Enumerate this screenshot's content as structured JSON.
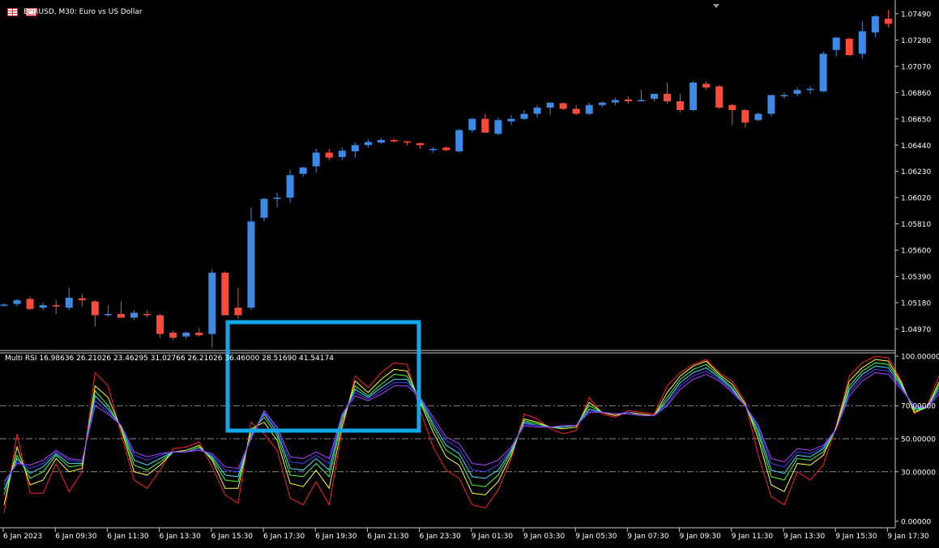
{
  "window": {
    "title": "EURUSD, M30:  Euro vs US Dollar"
  },
  "icons": [
    "chart-window-icon",
    "restore-icon"
  ],
  "colors": {
    "background": "#000000",
    "bull": "#3d8ae6",
    "bear": "#ff4a3a",
    "axis": "#c8c8c8",
    "level_line": "#8a8a8a",
    "highlight_box": "#11a7e8"
  },
  "price_axis": {
    "labels": [
      "1.07490",
      "1.07280",
      "1.07070",
      "1.06860",
      "1.06650",
      "1.06440",
      "1.06230",
      "1.06020",
      "1.05810",
      "1.05600",
      "1.05390",
      "1.05180",
      "1.04970"
    ]
  },
  "rsi_axis": {
    "labels": [
      "100.00000",
      "70.00000",
      "50.00000",
      "30.00000",
      "0.00000"
    ],
    "levels": [
      70,
      50,
      30
    ]
  },
  "time_axis": {
    "labels": [
      "6 Jan 2023",
      "6 Jan 09:30",
      "6 Jan 11:30",
      "6 Jan 13:30",
      "6 Jan 15:30",
      "6 Jan 17:30",
      "6 Jan 19:30",
      "6 Jan 21:30",
      "6 Jan 23:30",
      "9 Jan 01:30",
      "9 Jan 03:30",
      "9 Jan 05:30",
      "9 Jan 07:30",
      "9 Jan 09:30",
      "9 Jan 11:30",
      "9 Jan 13:30",
      "9 Jan 15:30",
      "9 Jan 17:30"
    ]
  },
  "indicator": {
    "title": "Multi RSI 16.98636 26.21026 23.46295 31.02766 26.21026 36.46000 28.51690 41.54174",
    "values": [
      16.98636,
      26.21026,
      23.46295,
      31.02766,
      26.21026,
      36.46,
      28.5169,
      41.54174
    ]
  },
  "chart_data": {
    "type": "candlestick",
    "symbol": "EURUSD",
    "timeframe": "M30",
    "candles": [
      {
        "o": 1.05165,
        "h": 1.05175,
        "l": 1.0515,
        "c": 1.05165
      },
      {
        "o": 1.0517,
        "h": 1.0521,
        "l": 1.0515,
        "c": 1.052
      },
      {
        "o": 1.0521,
        "h": 1.0523,
        "l": 1.0512,
        "c": 1.0513
      },
      {
        "o": 1.0514,
        "h": 1.0518,
        "l": 1.0512,
        "c": 1.0516
      },
      {
        "o": 1.0516,
        "h": 1.052,
        "l": 1.0509,
        "c": 1.0515
      },
      {
        "o": 1.0514,
        "h": 1.053,
        "l": 1.0512,
        "c": 1.0522
      },
      {
        "o": 1.05215,
        "h": 1.0525,
        "l": 1.0515,
        "c": 1.052
      },
      {
        "o": 1.0519,
        "h": 1.052,
        "l": 1.0499,
        "c": 1.0508
      },
      {
        "o": 1.0508,
        "h": 1.0516,
        "l": 1.0507,
        "c": 1.0509
      },
      {
        "o": 1.0509,
        "h": 1.0519,
        "l": 1.0506,
        "c": 1.0506
      },
      {
        "o": 1.0506,
        "h": 1.0512,
        "l": 1.0504,
        "c": 1.051
      },
      {
        "o": 1.0509,
        "h": 1.0512,
        "l": 1.0506,
        "c": 1.0508
      },
      {
        "o": 1.0508,
        "h": 1.0509,
        "l": 1.049,
        "c": 1.0493
      },
      {
        "o": 1.0494,
        "h": 1.0496,
        "l": 1.0488,
        "c": 1.049
      },
      {
        "o": 1.0491,
        "h": 1.0495,
        "l": 1.0489,
        "c": 1.0494
      },
      {
        "o": 1.0494,
        "h": 1.0498,
        "l": 1.0491,
        "c": 1.0492
      },
      {
        "o": 1.0493,
        "h": 1.0545,
        "l": 1.0482,
        "c": 1.0542
      },
      {
        "o": 1.0542,
        "h": 1.0543,
        "l": 1.0508,
        "c": 1.0508
      },
      {
        "o": 1.0514,
        "h": 1.053,
        "l": 1.0505,
        "c": 1.0508
      },
      {
        "o": 1.0514,
        "h": 1.0594,
        "l": 1.0512,
        "c": 1.0583
      },
      {
        "o": 1.0586,
        "h": 1.0602,
        "l": 1.0583,
        "c": 1.0601
      },
      {
        "o": 1.0601,
        "h": 1.0606,
        "l": 1.0594,
        "c": 1.0602
      },
      {
        "o": 1.0602,
        "h": 1.0624,
        "l": 1.0598,
        "c": 1.062
      },
      {
        "o": 1.0621,
        "h": 1.0627,
        "l": 1.0619,
        "c": 1.0626
      },
      {
        "o": 1.0627,
        "h": 1.0641,
        "l": 1.0622,
        "c": 1.0638
      },
      {
        "o": 1.0638,
        "h": 1.0641,
        "l": 1.0632,
        "c": 1.0634
      },
      {
        "o": 1.06345,
        "h": 1.0642,
        "l": 1.0632,
        "c": 1.06395
      },
      {
        "o": 1.0639,
        "h": 1.0646,
        "l": 1.0634,
        "c": 1.0644
      },
      {
        "o": 1.0644,
        "h": 1.0649,
        "l": 1.0642,
        "c": 1.06465
      },
      {
        "o": 1.0646,
        "h": 1.06495,
        "l": 1.0645,
        "c": 1.0648
      },
      {
        "o": 1.0648,
        "h": 1.0649,
        "l": 1.0646,
        "c": 1.0647
      },
      {
        "o": 1.0647,
        "h": 1.06475,
        "l": 1.0644,
        "c": 1.0646
      },
      {
        "o": 1.06455,
        "h": 1.0646,
        "l": 1.0641,
        "c": 1.0644
      },
      {
        "o": 1.0641,
        "h": 1.0642,
        "l": 1.0638,
        "c": 1.0641
      },
      {
        "o": 1.0642,
        "h": 1.0643,
        "l": 1.0639,
        "c": 1.064
      },
      {
        "o": 1.0639,
        "h": 1.0657,
        "l": 1.0638,
        "c": 1.0656
      },
      {
        "o": 1.0656,
        "h": 1.0666,
        "l": 1.0654,
        "c": 1.0665
      },
      {
        "o": 1.0665,
        "h": 1.0669,
        "l": 1.0654,
        "c": 1.0654
      },
      {
        "o": 1.0653,
        "h": 1.0666,
        "l": 1.0652,
        "c": 1.0664
      },
      {
        "o": 1.0663,
        "h": 1.0668,
        "l": 1.066,
        "c": 1.0665
      },
      {
        "o": 1.0665,
        "h": 1.0672,
        "l": 1.0664,
        "c": 1.0669
      },
      {
        "o": 1.0669,
        "h": 1.0676,
        "l": 1.0666,
        "c": 1.0674
      },
      {
        "o": 1.0674,
        "h": 1.0678,
        "l": 1.0668,
        "c": 1.0678
      },
      {
        "o": 1.06775,
        "h": 1.0678,
        "l": 1.0672,
        "c": 1.0673
      },
      {
        "o": 1.0673,
        "h": 1.0676,
        "l": 1.0668,
        "c": 1.0669
      },
      {
        "o": 1.0669,
        "h": 1.0678,
        "l": 1.0668,
        "c": 1.0676
      },
      {
        "o": 1.0676,
        "h": 1.0679,
        "l": 1.0674,
        "c": 1.0678
      },
      {
        "o": 1.0678,
        "h": 1.0682,
        "l": 1.0676,
        "c": 1.068
      },
      {
        "o": 1.06805,
        "h": 1.0683,
        "l": 1.0677,
        "c": 1.0679
      },
      {
        "o": 1.0679,
        "h": 1.0688,
        "l": 1.0679,
        "c": 1.068
      },
      {
        "o": 1.0681,
        "h": 1.0685,
        "l": 1.0679,
        "c": 1.0685
      },
      {
        "o": 1.0685,
        "h": 1.0694,
        "l": 1.0677,
        "c": 1.0679
      },
      {
        "o": 1.0679,
        "h": 1.0685,
        "l": 1.067,
        "c": 1.0672
      },
      {
        "o": 1.0672,
        "h": 1.0695,
        "l": 1.0671,
        "c": 1.0694
      },
      {
        "o": 1.0693,
        "h": 1.0695,
        "l": 1.0688,
        "c": 1.069
      },
      {
        "o": 1.0691,
        "h": 1.0692,
        "l": 1.0673,
        "c": 1.0674
      },
      {
        "o": 1.0676,
        "h": 1.0677,
        "l": 1.066,
        "c": 1.0672
      },
      {
        "o": 1.0672,
        "h": 1.0673,
        "l": 1.0658,
        "c": 1.0662
      },
      {
        "o": 1.0664,
        "h": 1.067,
        "l": 1.0663,
        "c": 1.0669
      },
      {
        "o": 1.0669,
        "h": 1.0684,
        "l": 1.0667,
        "c": 1.0684
      },
      {
        "o": 1.0684,
        "h": 1.0686,
        "l": 1.0681,
        "c": 1.0684
      },
      {
        "o": 1.0685,
        "h": 1.069,
        "l": 1.0683,
        "c": 1.0688
      },
      {
        "o": 1.0688,
        "h": 1.0691,
        "l": 1.0685,
        "c": 1.0689
      },
      {
        "o": 1.0687,
        "h": 1.0719,
        "l": 1.0686,
        "c": 1.0717
      },
      {
        "o": 1.072,
        "h": 1.073,
        "l": 1.0715,
        "c": 1.073
      },
      {
        "o": 1.0729,
        "h": 1.073,
        "l": 1.0715,
        "c": 1.0716
      },
      {
        "o": 1.0717,
        "h": 1.0743,
        "l": 1.0713,
        "c": 1.0735
      },
      {
        "o": 1.0734,
        "h": 1.0748,
        "l": 1.073,
        "c": 1.0747
      },
      {
        "o": 1.0745,
        "h": 1.0752,
        "l": 1.0738,
        "c": 1.0741
      }
    ],
    "rsi_series": [
      {
        "color": "#ff2020",
        "values": [
          5,
          53,
          17,
          17,
          35,
          18,
          30,
          90,
          82,
          53,
          25,
          20,
          31,
          44,
          45,
          48,
          33,
          16,
          11,
          60,
          53,
          43,
          14,
          10,
          24,
          10,
          55,
          88,
          81,
          90,
          96,
          95,
          67,
          45,
          31,
          26,
          10,
          8,
          19,
          38,
          65,
          62,
          56,
          53,
          55,
          75,
          65,
          63,
          67,
          66,
          65,
          82,
          90,
          95,
          98,
          90,
          85,
          72,
          40,
          15,
          10,
          30,
          25,
          34,
          58,
          88,
          96,
          100,
          99,
          85,
          65,
          70,
          90,
          70
        ]
      },
      {
        "color": "#ffff30",
        "values": [
          10,
          45,
          22,
          25,
          38,
          30,
          32,
          82,
          75,
          56,
          30,
          28,
          34,
          42,
          43,
          46,
          37,
          20,
          20,
          56,
          60,
          49,
          23,
          21,
          31,
          20,
          58,
          85,
          78,
          86,
          92,
          91,
          72,
          54,
          39,
          34,
          17,
          16,
          24,
          40,
          62,
          60,
          57,
          56,
          57,
          72,
          66,
          64,
          66,
          65,
          64,
          78,
          88,
          94,
          97,
          89,
          83,
          71,
          50,
          22,
          18,
          35,
          34,
          40,
          57,
          85,
          93,
          98,
          97,
          84,
          66,
          69,
          86,
          72
        ]
      },
      {
        "color": "#40ff40",
        "values": [
          16,
          40,
          26,
          30,
          40,
          33,
          34,
          79,
          70,
          57,
          34,
          31,
          36,
          42,
          42,
          45,
          38,
          25,
          24,
          54,
          63,
          52,
          28,
          27,
          35,
          27,
          61,
          82,
          76,
          83,
          89,
          88,
          73,
          57,
          43,
          38,
          22,
          21,
          28,
          42,
          61,
          59,
          57,
          57,
          58,
          70,
          66,
          65,
          66,
          64,
          64,
          75,
          86,
          92,
          95,
          88,
          81,
          70,
          53,
          27,
          25,
          38,
          37,
          42,
          56,
          82,
          91,
          96,
          95,
          83,
          67,
          69,
          84,
          74
        ]
      },
      {
        "color": "#40e0ff",
        "values": [
          19,
          38,
          29,
          33,
          41,
          35,
          35,
          76,
          68,
          58,
          37,
          34,
          38,
          42,
          42,
          44,
          39,
          28,
          27,
          52,
          65,
          54,
          32,
          31,
          38,
          31,
          63,
          80,
          75,
          81,
          86,
          86,
          74,
          59,
          46,
          41,
          27,
          26,
          31,
          43,
          60,
          58,
          57,
          57,
          58,
          68,
          66,
          65,
          66,
          64,
          64,
          73,
          84,
          90,
          93,
          87,
          80,
          70,
          55,
          31,
          29,
          40,
          39,
          44,
          56,
          80,
          89,
          94,
          93,
          82,
          68,
          69,
          82,
          75
        ]
      },
      {
        "color": "#4040ff",
        "values": [
          22,
          36,
          32,
          35,
          42,
          37,
          36,
          73,
          66,
          58,
          40,
          37,
          40,
          42,
          42,
          44,
          40,
          31,
          30,
          51,
          66,
          56,
          36,
          35,
          40,
          35,
          64,
          78,
          74,
          79,
          84,
          84,
          75,
          61,
          49,
          44,
          31,
          30,
          34,
          44,
          59,
          58,
          57,
          58,
          58,
          67,
          66,
          65,
          66,
          64,
          64,
          71,
          82,
          88,
          91,
          86,
          79,
          70,
          57,
          35,
          33,
          42,
          41,
          45,
          56,
          78,
          87,
          92,
          91,
          81,
          69,
          69,
          80,
          76
        ]
      },
      {
        "color": "#b040ff",
        "values": [
          24,
          35,
          34,
          37,
          43,
          38,
          37,
          70,
          65,
          58,
          42,
          39,
          41,
          42,
          42,
          43,
          41,
          33,
          32,
          50,
          67,
          57,
          39,
          38,
          42,
          38,
          65,
          76,
          73,
          77,
          82,
          82,
          75,
          63,
          51,
          47,
          35,
          34,
          37,
          45,
          58,
          57,
          57,
          58,
          58,
          66,
          66,
          65,
          65,
          64,
          64,
          70,
          80,
          86,
          89,
          85,
          78,
          70,
          58,
          38,
          36,
          44,
          43,
          46,
          56,
          76,
          85,
          90,
          89,
          80,
          70,
          69,
          78,
          77
        ]
      }
    ]
  }
}
